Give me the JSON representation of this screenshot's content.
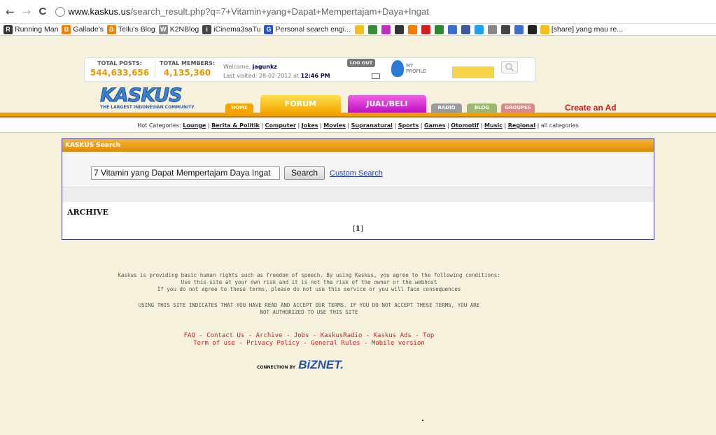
{
  "browser": {
    "back": "←",
    "forward": "→",
    "reload": "C",
    "url_host": "www.kaskus.us",
    "url_path": "/search_result.php?q=7+Vitamin+yang+Dapat+Mempertajam+Daya+Ingat"
  },
  "bookmarks": [
    {
      "label": "Running Man",
      "color": "#333333",
      "icon": "R"
    },
    {
      "label": "Gallade's",
      "color": "#f57d00",
      "icon": "B"
    },
    {
      "label": "Tellu's Blog",
      "color": "#f57d00",
      "icon": "B"
    },
    {
      "label": "K2NBlog",
      "color": "#888888",
      "icon": "W"
    },
    {
      "label": "iCinema3saTu",
      "color": "#444444",
      "icon": "i"
    },
    {
      "label": "Personal search engi...",
      "color": "#2255cc",
      "icon": "G"
    }
  ],
  "bookmark_last": "[share] yang mau re...",
  "stats": {
    "posts_label": "TOTAL POSTS:",
    "posts_value": "544,633,656",
    "members_label": "TOTAL MEMBERS:",
    "members_value": "4,135,360",
    "welcome_prefix": "Welcome,",
    "username": "jagunkz",
    "last_visited_prefix": "Last visited: 28-02-2012 at",
    "last_visited_time": "12:46 PM",
    "logout": "LOG OUT",
    "my": "MY",
    "profile": "PROFILE"
  },
  "logo": {
    "word": "KASKUS",
    "tagline": "THE LARGEST INDONESIAN COMMUNITY"
  },
  "tabs": {
    "home": "HOME",
    "forum": "FORUM",
    "jual": "JUAL/BELI",
    "radio": "RADIO",
    "blog": "BLOG",
    "groupee": "GROUPEE"
  },
  "create_ad": "Create an Ad",
  "hot_categories": {
    "prefix": "Hot Categories:",
    "items": [
      "Lounge",
      "Berita & Politik",
      "Computer",
      "Jokes",
      "Movies",
      "Supranatural",
      "Sports",
      "Games",
      "Otomotif",
      "Music",
      "Regional"
    ],
    "all": "all categories"
  },
  "search": {
    "title": "KASKUS Search",
    "query": "7 Vitamin yang Dapat Mempertajam Daya Ingat",
    "button": "Search",
    "custom": "Custom Search",
    "archive": "ARCHIVE",
    "page": "1"
  },
  "footer": {
    "terms_line1": "Kaskus is providing basic human rights such as freedom of speech. By using Kaskus, you agree to the following conditions:",
    "terms_line2": "Use this site at your own risk and it is not the risk of the owner or the webhost",
    "terms_line3": "If you do not agree to these terms, please do not use this service or you will face consequences",
    "accept_line1": "USING THIS SITE INDICATES THAT YOU HAVE READ AND ACCEPT OUR TERMS. IF YOU DO NOT ACCEPT THESE TERMS, YOU ARE",
    "accept_line2": "NOT AUTHORIZED TO USE THIS SITE",
    "links_line1": [
      "FAQ",
      "Contact Us",
      "Archive",
      "Jobs",
      "KaskusRadio",
      "Kaskus Ads",
      "Top"
    ],
    "links_line2": [
      "Term of use",
      "Privacy Policy",
      "General Rules",
      "Mobile version"
    ],
    "connection": "CONNECTION BY",
    "biznet": "BiZNET."
  }
}
